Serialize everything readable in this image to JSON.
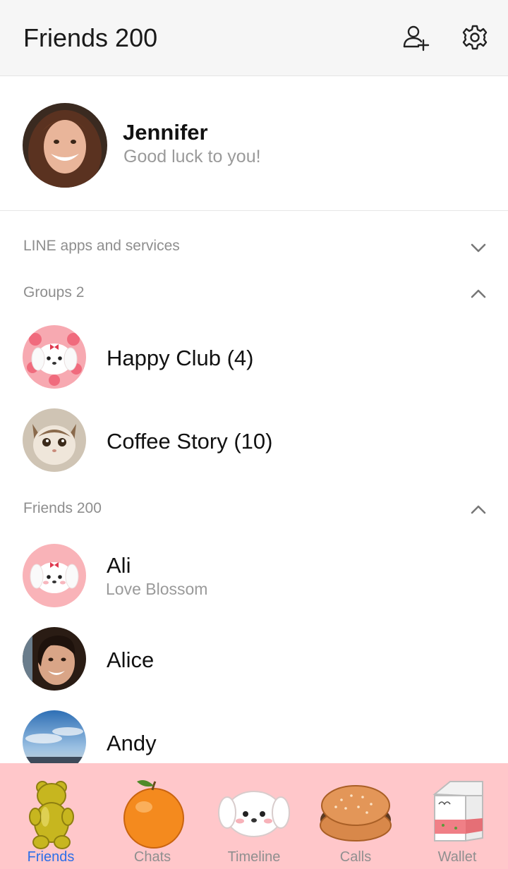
{
  "header": {
    "title": "Friends 200"
  },
  "profile": {
    "name": "Jennifer",
    "status": "Good luck to you!"
  },
  "sections": [
    {
      "label": "LINE apps and services",
      "state": "collapsed"
    },
    {
      "label": "Groups 2",
      "state": "expanded"
    },
    {
      "label": "Friends 200",
      "state": "expanded"
    }
  ],
  "groups": [
    {
      "name": "Happy Club (4)"
    },
    {
      "name": "Coffee Story (10)"
    }
  ],
  "friends": [
    {
      "name": "Ali",
      "status": "Love Blossom"
    },
    {
      "name": "Alice"
    },
    {
      "name": "Andy"
    }
  ],
  "tabs": [
    {
      "label": "Friends",
      "active": true
    },
    {
      "label": "Chats"
    },
    {
      "label": "Timeline"
    },
    {
      "label": "Calls"
    },
    {
      "label": "Wallet"
    }
  ],
  "colors": {
    "tabbar": "#ffc7ca",
    "active_tab": "#2a6ee8",
    "muted_text": "#8e8e8e"
  }
}
